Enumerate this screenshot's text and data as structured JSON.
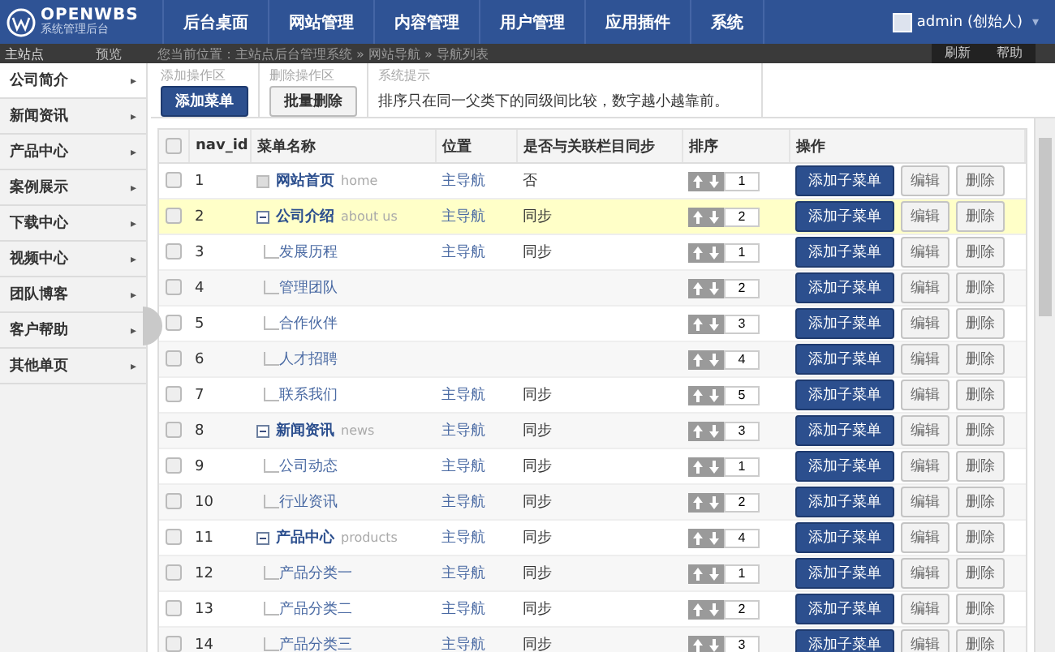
{
  "logo": {
    "name": "OPENWBS",
    "subtitle": "系统管理后台"
  },
  "top_nav": [
    {
      "label": "后台桌面",
      "selected": false
    },
    {
      "label": "网站管理",
      "selected": false
    },
    {
      "label": "内容管理",
      "selected": false
    },
    {
      "label": "用户管理",
      "selected": false
    },
    {
      "label": "应用插件",
      "selected": false
    },
    {
      "label": "系统",
      "selected": false
    }
  ],
  "user": {
    "name": "admin (创始人)",
    "caret": "▾"
  },
  "sub_bar": {
    "site": "主站点",
    "preview": "预览",
    "breadcrumb": "您当前位置：主站点后台管理系统 » 网站导航 » 导航列表",
    "actions": [
      "刷新",
      "帮助"
    ]
  },
  "sidebar": {
    "items": [
      {
        "label": "公司简介",
        "selected": true
      },
      {
        "label": "新闻资讯",
        "selected": false
      },
      {
        "label": "产品中心",
        "selected": false
      },
      {
        "label": "案例展示",
        "selected": false
      },
      {
        "label": "下载中心",
        "selected": false
      },
      {
        "label": "视频中心",
        "selected": false
      },
      {
        "label": "团队博客",
        "selected": false
      },
      {
        "label": "客户帮助",
        "selected": false
      },
      {
        "label": "其他单页",
        "selected": false
      }
    ],
    "arrow": "▸"
  },
  "toolbar": [
    {
      "kind": "button",
      "title": "添加操作区",
      "label": "添加菜单",
      "primary": true
    },
    {
      "kind": "button",
      "title": "删除操作区",
      "label": "批量删除",
      "primary": false
    },
    {
      "kind": "note",
      "title": "系统提示",
      "label": "排序只在同一父类下的同级间比较，数字越小越靠前。"
    }
  ],
  "table": {
    "select_all": {
      "checked": false
    },
    "columns": [
      "nav_id",
      "菜单名称",
      "位置",
      "是否与关联栏目同步",
      "排序",
      "操作"
    ],
    "rows": [
      {
        "id": "1",
        "name": "网站首页",
        "en": "home",
        "position": "主导航",
        "sync": "否",
        "order": "1",
        "checked": false,
        "highlighted": false,
        "expanded": false,
        "actions": [
          "添加子菜单",
          "编辑",
          "删除"
        ]
      },
      {
        "id": "2",
        "name": "公司介绍",
        "en": "about us",
        "position": "主导航",
        "sync": "同步",
        "order": "2",
        "checked": false,
        "highlighted": true,
        "expanded": true,
        "actions": [
          "添加子菜单",
          "编辑",
          "删除"
        ],
        "children": [
          {
            "id": "3",
            "name": "发展历程",
            "position": "主导航",
            "sync": "同步",
            "order": "1",
            "checked": false,
            "highlighted": false,
            "actions": [
              "添加子菜单",
              "编辑",
              "删除"
            ]
          },
          {
            "id": "4",
            "name": "管理团队",
            "order": "2",
            "checked": false,
            "highlighted": false,
            "actions": [
              "添加子菜单",
              "编辑",
              "删除"
            ]
          },
          {
            "id": "5",
            "name": "合作伙伴",
            "order": "3",
            "checked": false,
            "highlighted": false,
            "actions": [
              "添加子菜单",
              "编辑",
              "删除"
            ]
          },
          {
            "id": "6",
            "name": "人才招聘",
            "order": "4",
            "checked": false,
            "highlighted": false,
            "actions": [
              "添加子菜单",
              "编辑",
              "删除"
            ]
          },
          {
            "id": "7",
            "name": "联系我们",
            "position": "主导航",
            "sync": "同步",
            "order": "5",
            "checked": false,
            "highlighted": false,
            "actions": [
              "添加子菜单",
              "编辑",
              "删除"
            ]
          }
        ]
      },
      {
        "id": "8",
        "name": "新闻资讯",
        "en": "news",
        "position": "主导航",
        "sync": "同步",
        "order": "3",
        "checked": false,
        "highlighted": false,
        "expanded": true,
        "actions": [
          "添加子菜单",
          "编辑",
          "删除"
        ],
        "children": [
          {
            "id": "9",
            "name": "公司动态",
            "position": "主导航",
            "sync": "同步",
            "order": "1",
            "checked": false,
            "highlighted": false,
            "actions": [
              "添加子菜单",
              "编辑",
              "删除"
            ]
          },
          {
            "id": "10",
            "name": "行业资讯",
            "position": "主导航",
            "sync": "同步",
            "order": "2",
            "checked": false,
            "highlighted": false,
            "actions": [
              "添加子菜单",
              "编辑",
              "删除"
            ]
          }
        ]
      },
      {
        "id": "11",
        "name": "产品中心",
        "en": "products",
        "position": "主导航",
        "sync": "同步",
        "order": "4",
        "checked": false,
        "highlighted": false,
        "expanded": true,
        "actions": [
          "添加子菜单",
          "编辑",
          "删除"
        ],
        "children": [
          {
            "id": "12",
            "name": "产品分类一",
            "position": "主导航",
            "sync": "同步",
            "order": "1",
            "checked": false,
            "highlighted": false,
            "actions": [
              "添加子菜单",
              "编辑",
              "删除"
            ]
          },
          {
            "id": "13",
            "name": "产品分类二",
            "position": "主导航",
            "sync": "同步",
            "order": "2",
            "checked": false,
            "highlighted": false,
            "actions": [
              "添加子菜单",
              "编辑",
              "删除"
            ]
          },
          {
            "id": "14",
            "name": "产品分类三",
            "position": "主导航",
            "sync": "同步",
            "order": "3",
            "checked": false,
            "highlighted": false,
            "actions": [
              "添加子菜单",
              "编辑",
              "删除"
            ]
          }
        ]
      }
    ]
  }
}
